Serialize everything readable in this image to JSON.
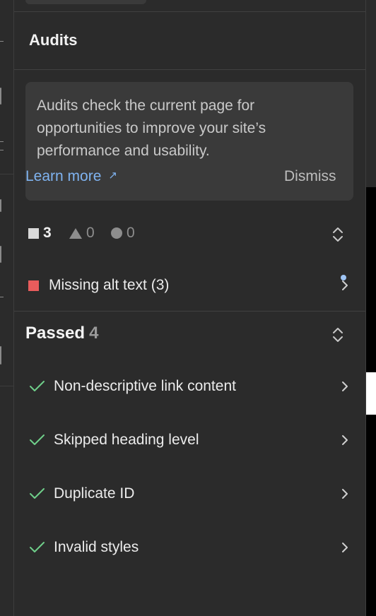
{
  "panel": {
    "title": "Audits"
  },
  "info": {
    "text": "Audits check the current page for opportunities to improve your site’s performance and usability.",
    "learn_more": "Learn more",
    "dismiss": "Dismiss"
  },
  "counts": {
    "errors": "3",
    "warnings": "0",
    "notices": "0"
  },
  "issues": [
    {
      "label": "Missing alt text (3)",
      "color": "#e85c5c"
    }
  ],
  "passed": {
    "title": "Passed",
    "count": "4",
    "items": [
      {
        "label": "Non-descriptive link content"
      },
      {
        "label": "Skipped heading level"
      },
      {
        "label": "Duplicate ID"
      },
      {
        "label": "Invalid styles"
      }
    ]
  },
  "colors": {
    "accent_link": "#7fb3f0",
    "error": "#e85c5c",
    "check": "#6fcf8a"
  }
}
